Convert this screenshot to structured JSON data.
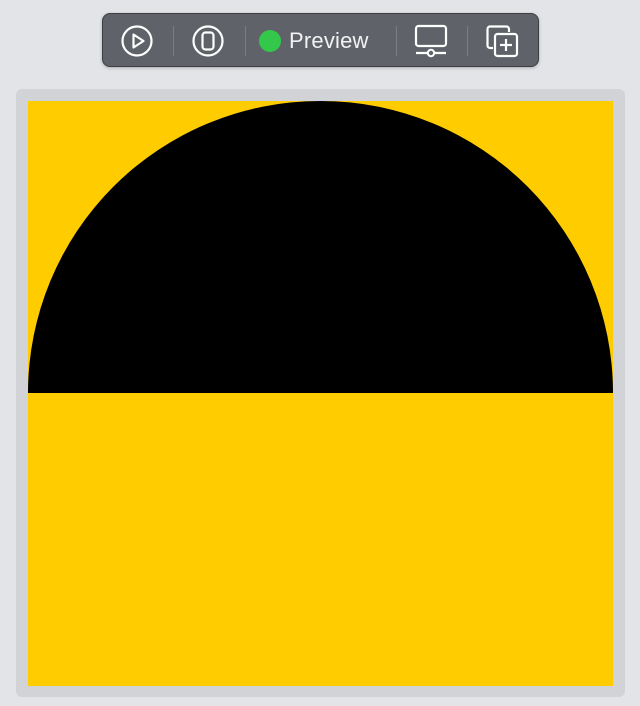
{
  "toolbar": {
    "live_button_icon": "play-circle-icon",
    "device_button_icon": "device-icon",
    "preview_status_color": "#34c84a",
    "preview_label": "Preview",
    "settings_button_icon": "display-settings-icon",
    "duplicate_button_icon": "duplicate-plus-icon"
  },
  "canvas": {
    "background_color": "#ffcc00",
    "shape": "half-circle",
    "shape_color": "#000000"
  }
}
